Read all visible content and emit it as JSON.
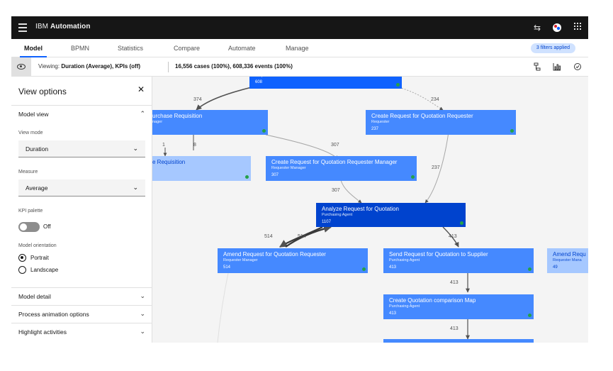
{
  "app": {
    "brand_prefix": "IBM",
    "brand_name": "Automation"
  },
  "tabs": [
    {
      "label": "Model"
    },
    {
      "label": "BPMN"
    },
    {
      "label": "Statistics"
    },
    {
      "label": "Compare"
    },
    {
      "label": "Automate"
    },
    {
      "label": "Manage"
    }
  ],
  "filter_tag": "3 filters applied",
  "summary": {
    "viewing_label": "Viewing:",
    "viewing_value": "Duration (Average), KPIs (off)",
    "cases": "16,556 cases (100%), 608,336 events (100%)"
  },
  "panel": {
    "title": "View options",
    "model_view": "Model view",
    "view_mode_label": "View mode",
    "view_mode_value": "Duration",
    "measure_label": "Measure",
    "measure_value": "Average",
    "kpi_label": "KPI palette",
    "kpi_state": "Off",
    "orientation_label": "Model orientation",
    "portrait": "Portrait",
    "landscape": "Landscape",
    "model_detail": "Model detail",
    "animation": "Process animation options",
    "highlight": "Highlight activities"
  },
  "nodes": [
    {
      "title": "",
      "role": "Requester",
      "count": "608",
      "color": "#0f62fe"
    },
    {
      "title": "urchase Requisition",
      "role": "nager",
      "count": "",
      "color": "#4589ff"
    },
    {
      "title": "Create Request for Quotation Requester",
      "role": "Requester",
      "count": "237",
      "color": "#4589ff"
    },
    {
      "title": "e Requisition",
      "role": "",
      "count": "",
      "color": "#a6c8ff"
    },
    {
      "title": "Create Request for Quotation Requester Manager",
      "role": "Requester Manager",
      "count": "307",
      "color": "#4589ff"
    },
    {
      "title": "Analyze Request for Quotation",
      "role": "Purchasing Agent",
      "count": "1107",
      "color": "#0043ce"
    },
    {
      "title": "Amend Request for Quotation Requester",
      "role": "Requester Manager",
      "count": "514",
      "color": "#4589ff"
    },
    {
      "title": "Send Request for Quotation to Supplier",
      "role": "Purchasing Agent",
      "count": "413",
      "color": "#4589ff"
    },
    {
      "title": "Amend Requ",
      "role": "Requester Mana",
      "count": "49",
      "color": "#a6c8ff"
    },
    {
      "title": "Create Quotation comparison Map",
      "role": "Purchasing Agent",
      "count": "413",
      "color": "#4589ff"
    },
    {
      "title": "",
      "role": "",
      "count": "",
      "color": "#4589ff"
    }
  ],
  "edges": [
    {
      "label": "374"
    },
    {
      "label": "234"
    },
    {
      "label": "1"
    },
    {
      "label": "8"
    },
    {
      "label": "307"
    },
    {
      "label": "237"
    },
    {
      "label": "307"
    },
    {
      "label": "514"
    },
    {
      "label": "514"
    },
    {
      "label": "413"
    },
    {
      "label": "413"
    },
    {
      "label": "413"
    }
  ]
}
